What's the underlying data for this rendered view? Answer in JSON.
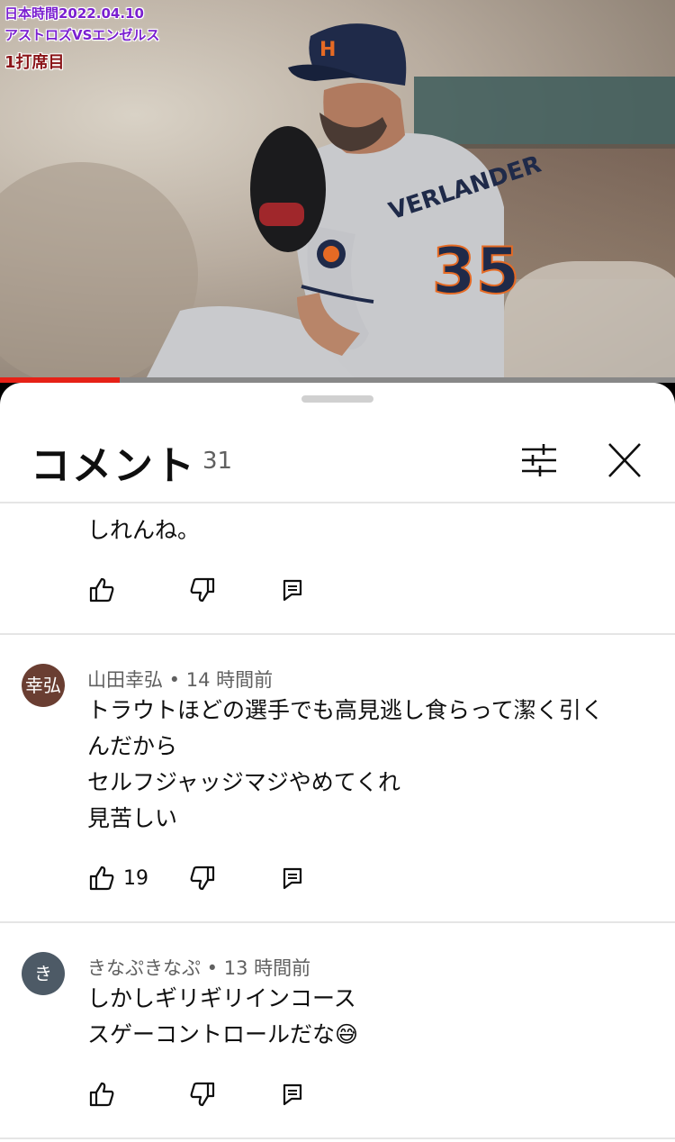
{
  "video": {
    "overlay_line1": "日本時間2022.04.10",
    "overlay_line2": "アストロズVSエンゼルス",
    "overlay_line3": "1打席目",
    "progress": 0.177,
    "colors": {
      "progress": "#e62117",
      "overlay_purple": "#7a1fd0",
      "overlay_red": "#8a1418"
    }
  },
  "sheet": {
    "title": "コメント",
    "count": "31",
    "filter_icon": "sliders-icon",
    "close_icon": "close-icon"
  },
  "comments": [
    {
      "partial": true,
      "text": "しれんね。",
      "likes": ""
    },
    {
      "avatar_text": "幸弘",
      "avatar_color": "#6a3e32",
      "meta": "山田幸弘 • 14 時間前",
      "text": "トラウトほどの選手でも高見逃し食らって潔く引く\nんだから\nセルフジャッジマジやめてくれ\n見苦しい",
      "likes": "19"
    },
    {
      "avatar_text": "き",
      "avatar_color": "#4d5a66",
      "meta": "きなぷきなぷ • 13 時間前",
      "text": "しかしギリギリインコース\nスゲーコントロールだな😅",
      "likes": ""
    }
  ]
}
